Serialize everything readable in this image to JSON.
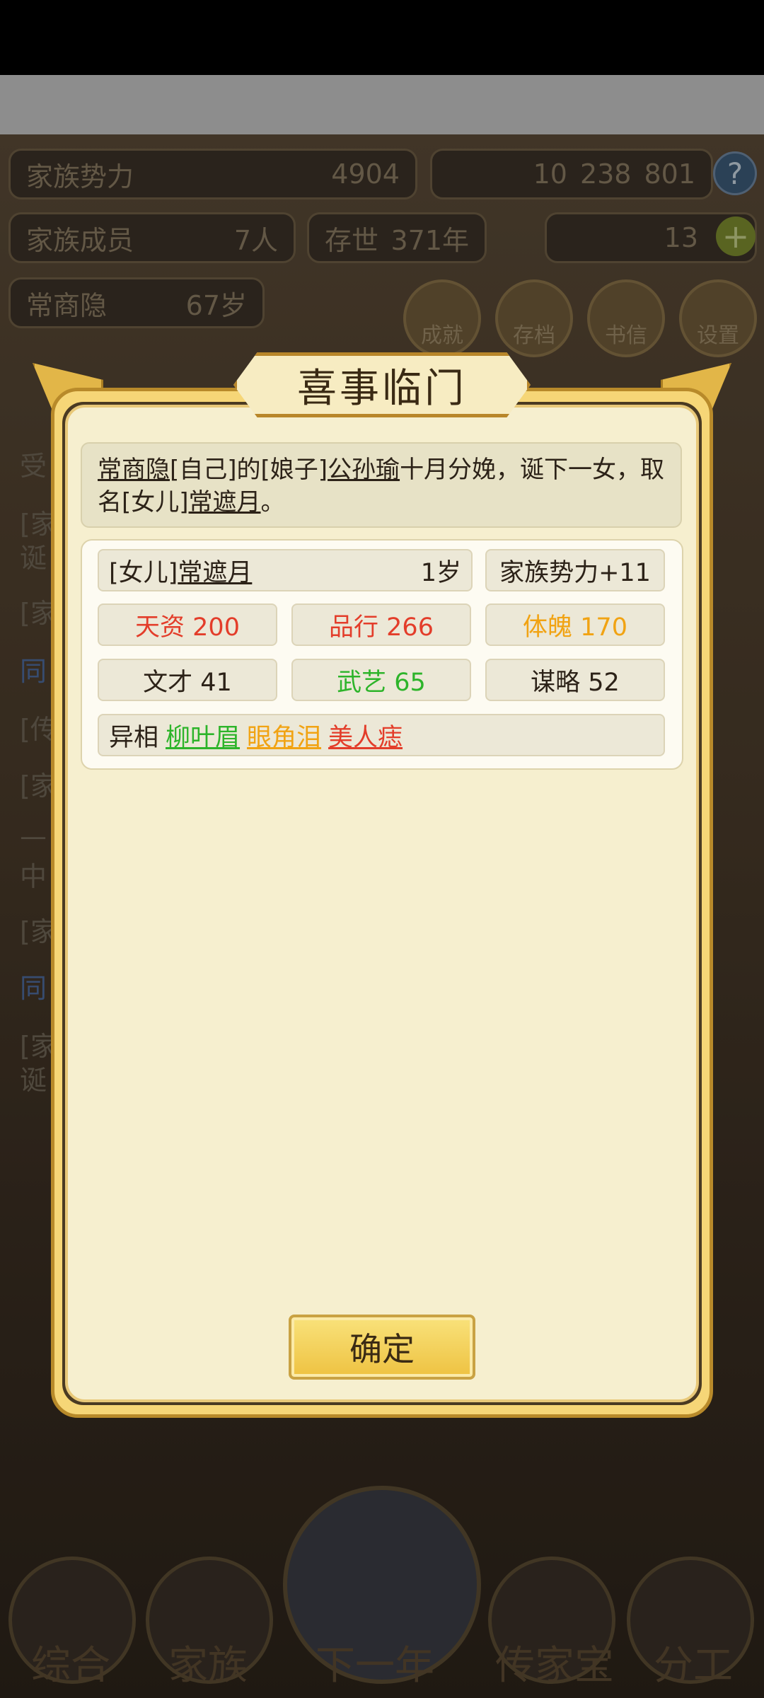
{
  "hud": {
    "power_label": "家族势力",
    "power_value": "4904",
    "resources": [
      "10",
      "238",
      "801"
    ],
    "members_label": "家族成员",
    "members_value": "7人",
    "existence_label": "存世",
    "existence_value": "371年",
    "gold_value": "13",
    "leader_name": "常商隐",
    "leader_age": "67岁",
    "menu": [
      "成就",
      "存档",
      "书信",
      "设置"
    ]
  },
  "background_log": [
    "受",
    "[家",
    "诞",
    "[家",
    "同",
    "[传",
    "[家",
    "—",
    "中",
    "[家",
    "同",
    "[家",
    "诞"
  ],
  "bottom_tabs": [
    "综合",
    "家族",
    "下一年",
    "传家宝",
    "分工"
  ],
  "dialog": {
    "title": "喜事临门",
    "message": {
      "actor": "常商隐",
      "tag_self": "[自己]",
      "of": "的",
      "tag_wife": "[娘子]",
      "wife": "公孙瑜",
      "event": "十月分娩，诞下一女，取名",
      "tag_daughter": "[女儿]",
      "child": "常遮月",
      "end": "。"
    },
    "child": {
      "tag": "[女儿]",
      "name": "常遮月",
      "age": "1岁",
      "power_bonus": "家族势力+11"
    },
    "stats": [
      {
        "label": "天资 200",
        "color": "#e33d2a"
      },
      {
        "label": "品行 266",
        "color": "#e33d2a"
      },
      {
        "label": "体魄 170",
        "color": "#f1a313"
      },
      {
        "label": "文才 41",
        "color": "#2c2218"
      },
      {
        "label": "武艺 65",
        "color": "#2db42a"
      },
      {
        "label": "谋略 52",
        "color": "#2c2218"
      }
    ],
    "traits_label": "异相",
    "traits": [
      {
        "label": "柳叶眉",
        "color": "#2db42a"
      },
      {
        "label": "眼角泪",
        "color": "#f1a313"
      },
      {
        "label": "美人痣",
        "color": "#e33d2a"
      }
    ],
    "confirm_label": "确定"
  }
}
